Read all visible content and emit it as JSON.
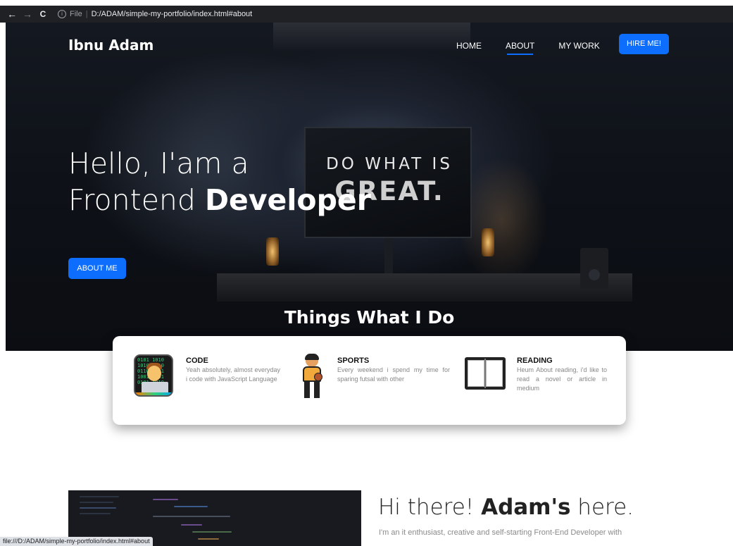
{
  "browser": {
    "back_icon": "←",
    "forward_icon": "→",
    "reload_icon": "C",
    "info_icon": "i",
    "url_scheme": "File",
    "url_path": "D:/ADAM/simple-my-portfolio/index.html#about",
    "status_url": "file:///D:/ADAM/simple-my-portfolio/index.html#about"
  },
  "navbar": {
    "brand": "Ibnu Adam",
    "links": [
      "HOME",
      "ABOUT",
      "MY WORK"
    ],
    "active": "ABOUT",
    "hire_button": "HIRE ME!",
    "accent_color": "#0d6efd"
  },
  "hero": {
    "line1": "Hello, I'am a",
    "line2_prefix": "Frontend ",
    "line2_bold": "Developer",
    "button": "ABOUT ME",
    "monitor_line1": "DO WHAT IS",
    "monitor_line2": "GREAT."
  },
  "things": {
    "title": "Things What I Do",
    "items": [
      {
        "title": "CODE",
        "description": "Yeah absolutely, almost everyday i code with JavaScript Language",
        "icon": "programmer-icon"
      },
      {
        "title": "SPORTS",
        "description": "Every weekend i spend my time for sparing futsal with other",
        "icon": "sportsperson-icon"
      },
      {
        "title": "READING",
        "description": "Heum About reading, i'd like to read a novel or article in medium",
        "icon": "open-book-icon"
      }
    ]
  },
  "about": {
    "heading_prefix": "Hi there! ",
    "heading_bold": "Adam's",
    "heading_suffix": " here.",
    "text": "I'm an it enthusiast, creative and self-starting Front-End Developer with"
  }
}
